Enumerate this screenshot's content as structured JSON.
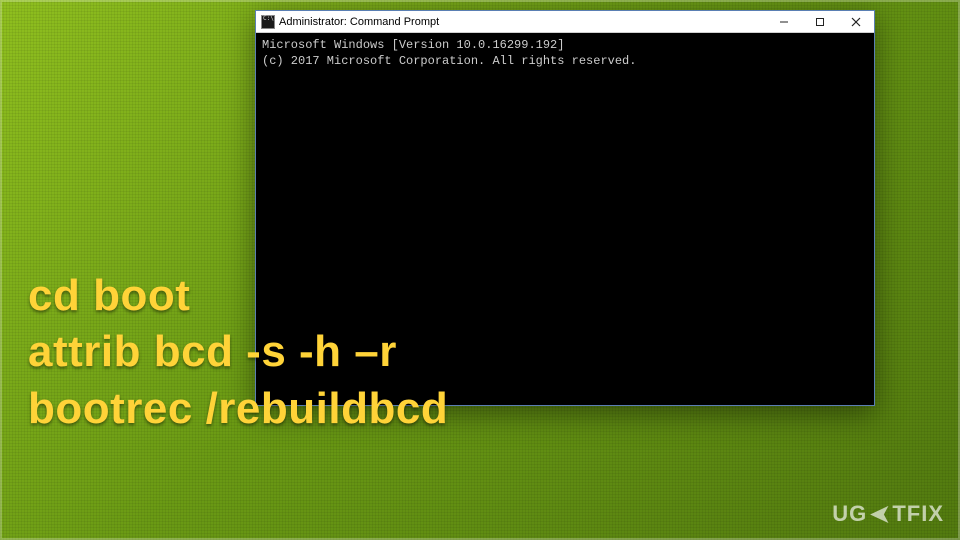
{
  "window": {
    "title": "Administrator: Command Prompt",
    "icon_name": "cmd-icon"
  },
  "console": {
    "line1": "Microsoft Windows [Version 10.0.16299.192]",
    "line2": "(c) 2017 Microsoft Corporation. All rights reserved."
  },
  "overlay": {
    "cmd1": "cd boot",
    "cmd2": "attrib bcd -s -h –r",
    "cmd3": "bootrec /rebuildbcd"
  },
  "watermark": {
    "part1": "UG",
    "part2": "TFIX"
  },
  "colors": {
    "overlay_text": "#ffd338",
    "console_bg": "#000000",
    "console_fg": "#cccccc"
  }
}
